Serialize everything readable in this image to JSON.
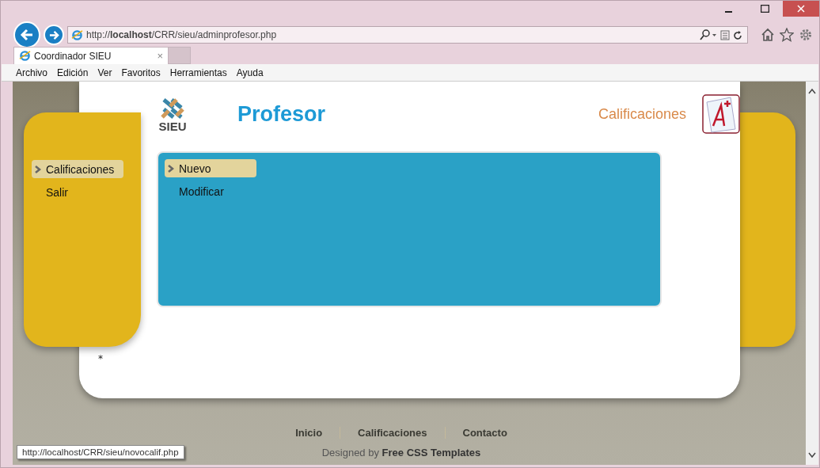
{
  "browser": {
    "address": "http://**localhost**/CRR/sieu/adminprofesor.php",
    "tab": {
      "title": "Coordinador SIEU",
      "close": "×"
    },
    "menu": [
      "Archivo",
      "Edición",
      "Ver",
      "Favoritos",
      "Herramientas",
      "Ayuda"
    ]
  },
  "header": {
    "logo_text": "SIEU",
    "title": "Profesor",
    "section": "Calificaciones"
  },
  "sidebar": {
    "items": [
      {
        "label": "Calificaciones",
        "selected": true
      },
      {
        "label": "Salir",
        "selected": false
      }
    ]
  },
  "submenu": {
    "items": [
      {
        "label": "Nuevo",
        "selected": true
      },
      {
        "label": "Modificar",
        "selected": false
      }
    ]
  },
  "note": "*",
  "footer": {
    "links": [
      "Inicio",
      "Calificaciones",
      "Contacto"
    ],
    "credit": "Designed by **Free CSS Templates**"
  },
  "status_bar": {
    "url": "http://localhost/CRR/sieu/novocalif.php"
  }
}
